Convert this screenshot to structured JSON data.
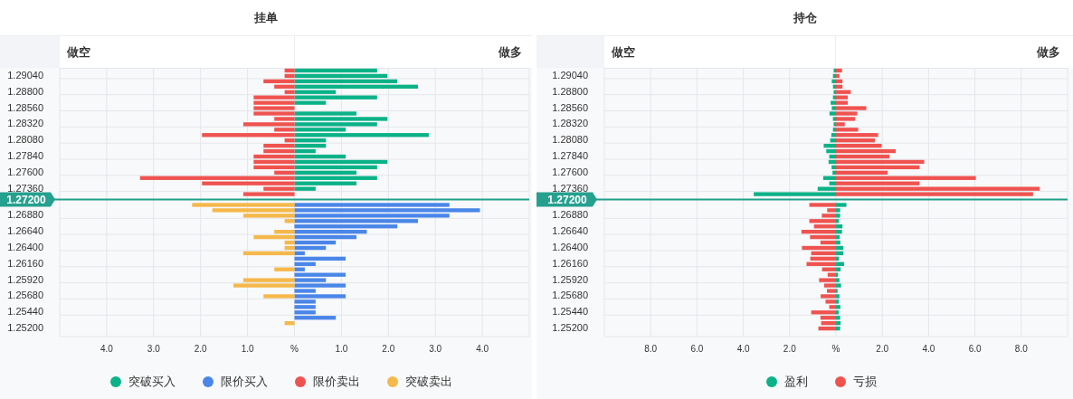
{
  "panels": [
    {
      "title": "挂单",
      "short_label": "做空",
      "long_label": "做多",
      "price_labels": [
        "1.29040",
        "1.28800",
        "1.28560",
        "1.28320",
        "1.28080",
        "1.27840",
        "1.27600",
        "1.27360",
        "1.26880",
        "1.26640",
        "1.26400",
        "1.26160",
        "1.25920",
        "1.25680",
        "1.25440",
        "1.25200"
      ],
      "current_price": "1.27200",
      "x_axis_labels": [
        "4.0",
        "3.0",
        "2.0",
        "1.0",
        "%",
        "1.0",
        "2.0",
        "3.0",
        "4.0"
      ],
      "legend": [
        {
          "name": "突破买入",
          "color": "#0bb287"
        },
        {
          "name": "限价买入",
          "color": "#4a86e8"
        },
        {
          "name": "限价卖出",
          "color": "#ef5350"
        },
        {
          "name": "突破卖出",
          "color": "#f5b84a"
        }
      ]
    },
    {
      "title": "持仓",
      "short_label": "做空",
      "long_label": "做多",
      "price_labels": [
        "1.29040",
        "1.28800",
        "1.28560",
        "1.28320",
        "1.28080",
        "1.27840",
        "1.27600",
        "1.27360",
        "1.26880",
        "1.26640",
        "1.26400",
        "1.26160",
        "1.25920",
        "1.25680",
        "1.25440",
        "1.25200"
      ],
      "current_price": "1.27200",
      "x_axis_labels": [
        "8.0",
        "6.0",
        "4.0",
        "2.0",
        "%",
        "2.0",
        "4.0",
        "6.0",
        "8.0"
      ],
      "legend": [
        {
          "name": "盈利",
          "color": "#0bb287"
        },
        {
          "name": "亏损",
          "color": "#ef5350"
        }
      ]
    }
  ]
}
